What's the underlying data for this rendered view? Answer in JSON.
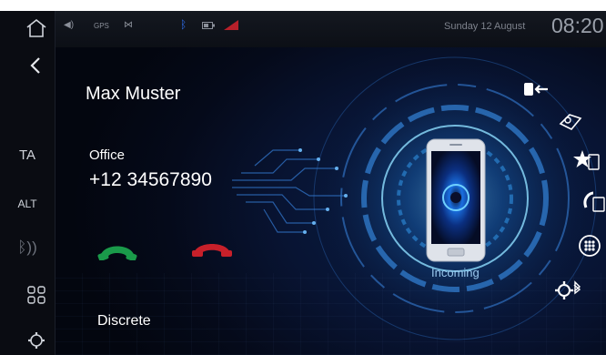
{
  "status": {
    "gps": "GPS",
    "date": "Sunday  12 August",
    "time": "08:20"
  },
  "sidebar": {
    "ta": "TA",
    "alt": "ALT"
  },
  "call": {
    "caller_name": "Max Muster",
    "number_type": "Office",
    "phone_number": "+12 34567890",
    "discrete_label": "Discrete",
    "status_text": "Incoming"
  },
  "colors": {
    "accept": "#1a9a4a",
    "decline": "#c8202a",
    "glow": "#2f8fe0",
    "bluetooth": "#2e6be6"
  },
  "icons": {
    "home": "home-icon",
    "back": "back-arrow-icon",
    "bluetooth_audio": "bluetooth-audio-icon",
    "apps": "apps-grid-icon",
    "settings": "settings-gear-icon",
    "transfer": "transfer-call-icon",
    "contacts": "contacts-book-icon",
    "favorites": "favorites-star-icon",
    "call_history": "call-history-icon",
    "keypad": "dialpad-icon",
    "bt_settings": "bluetooth-settings-icon"
  }
}
